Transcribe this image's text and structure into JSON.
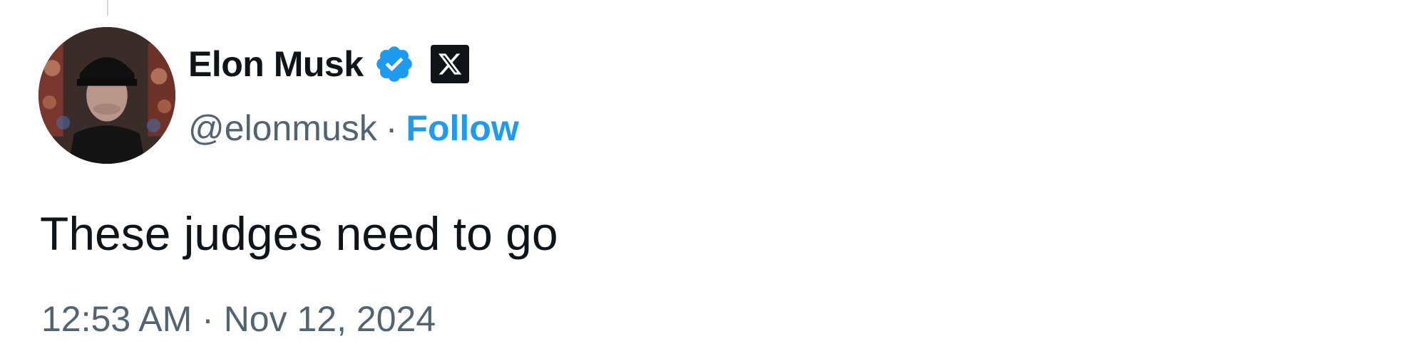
{
  "tweet": {
    "author": {
      "display_name": "Elon Musk",
      "handle": "@elonmusk",
      "verified_icon": "verified-badge-icon",
      "affiliation_icon": "x-logo-icon"
    },
    "follow_label": "Follow",
    "separator": "·",
    "text": "These judges need to go",
    "timestamp": "12:53 AM · Nov 12, 2024"
  },
  "colors": {
    "text_primary": "#0f1419",
    "text_secondary": "#536471",
    "accent_blue": "#1d9bf0",
    "background": "#ffffff"
  }
}
